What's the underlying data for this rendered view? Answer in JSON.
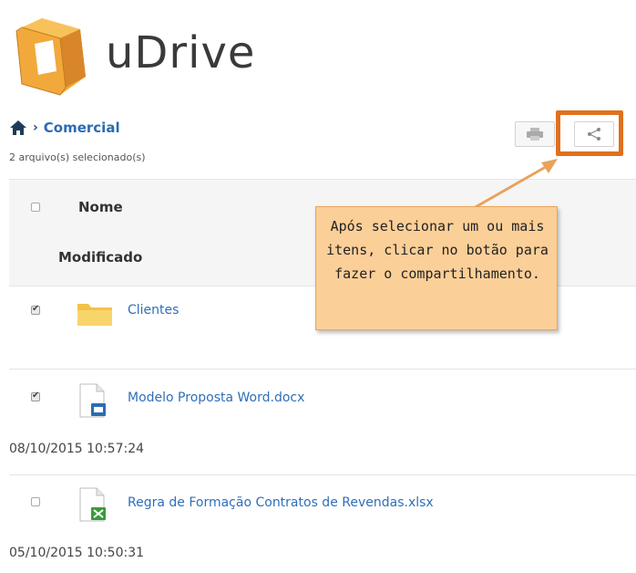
{
  "app": {
    "brand": "uDrive"
  },
  "breadcrumb": {
    "current": "Comercial"
  },
  "selection_status": "2 arquivo(s) selecionado(s)",
  "toolbar": {
    "print_icon": "print-icon",
    "share_icon": "share-icon"
  },
  "table": {
    "headers": {
      "name": "Nome",
      "modified": "Modificado"
    },
    "rows": [
      {
        "name": "Clientes",
        "type": "folder",
        "checked": true,
        "modified": ""
      },
      {
        "name": "Modelo Proposta Word.docx",
        "type": "word",
        "checked": true,
        "modified": "08/10/2015 10:57:24"
      },
      {
        "name": "Regra de Formação Contratos de Revendas.xlsx",
        "type": "excel",
        "checked": false,
        "modified": "05/10/2015 10:50:31"
      }
    ]
  },
  "callout": {
    "text": "Após selecionar um ou mais itens, clicar no botão para fazer o compartilhamento."
  },
  "colors": {
    "accent": "#e0701e",
    "link": "#2f6fba",
    "callout_bg": "#fbcf98"
  }
}
